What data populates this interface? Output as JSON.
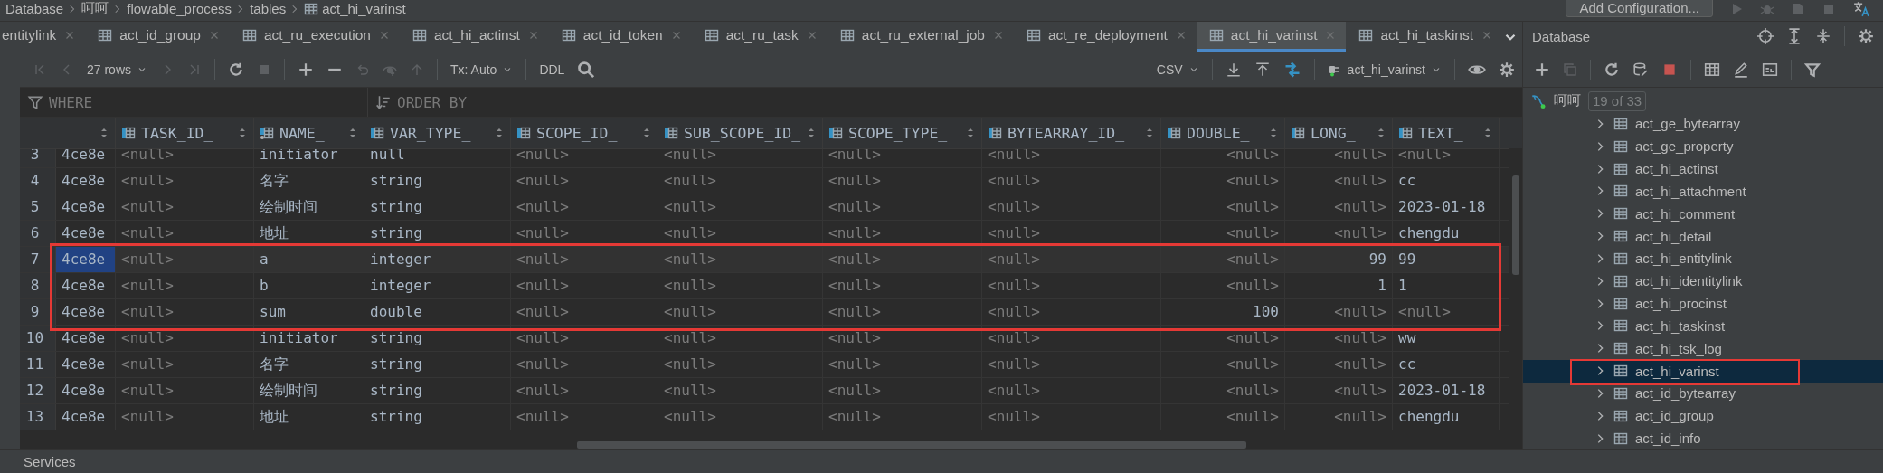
{
  "breadcrumb": [
    "Database",
    "呵呵",
    "flowable_process",
    "tables",
    "act_hi_varinst"
  ],
  "run_config": {
    "label": "Add Configuration..."
  },
  "tabs": [
    {
      "label": "entitylink",
      "kind": "partial",
      "selected": false
    },
    {
      "label": "act_id_group",
      "kind": "table",
      "selected": false
    },
    {
      "label": "act_ru_execution",
      "kind": "table",
      "selected": false
    },
    {
      "label": "act_hi_actinst",
      "kind": "table",
      "selected": false
    },
    {
      "label": "act_id_token",
      "kind": "table",
      "selected": false
    },
    {
      "label": "act_ru_task",
      "kind": "table",
      "selected": false
    },
    {
      "label": "act_ru_external_job",
      "kind": "table",
      "selected": false
    },
    {
      "label": "act_re_deployment",
      "kind": "table",
      "selected": false
    },
    {
      "label": "act_hi_varinst",
      "kind": "table",
      "selected": true
    },
    {
      "label": "act_hi_taskinst",
      "kind": "table",
      "selected": false
    }
  ],
  "toolbar": {
    "rows": "27 rows",
    "tx": "Tx: Auto",
    "ddl": "DDL",
    "format": "CSV",
    "datasource": "act_hi_varinst"
  },
  "filter": {
    "where": "WHERE",
    "order_by": "ORDER BY"
  },
  "table": {
    "columns": [
      {
        "kind": "text"
      },
      {
        "label": "TASK_ID_",
        "kind": "text",
        "indexed": false
      },
      {
        "label": "NAME_",
        "kind": "text",
        "indexed": true
      },
      {
        "label": "VAR_TYPE_",
        "kind": "text",
        "indexed": false
      },
      {
        "label": "SCOPE_ID_",
        "kind": "text",
        "indexed": false
      },
      {
        "label": "SUB_SCOPE_ID_",
        "kind": "text",
        "indexed": false
      },
      {
        "label": "SCOPE_TYPE_",
        "kind": "text",
        "indexed": false
      },
      {
        "label": "BYTEARRAY_ID_",
        "kind": "text",
        "indexed": false
      },
      {
        "label": "DOUBLE_",
        "kind": "number",
        "indexed": false
      },
      {
        "label": "LONG_",
        "kind": "number",
        "indexed": false
      },
      {
        "label": "TEXT_",
        "kind": "text",
        "indexed": false
      }
    ],
    "rows": [
      {
        "number": "3",
        "selected": false,
        "marked": false,
        "cells": [
          {
            "text": "4ce8e",
            "null": false
          },
          {
            "text": "<null>",
            "null": true
          },
          {
            "text": "initiator",
            "null": false
          },
          {
            "text": "null",
            "null": false
          },
          {
            "text": "<null>",
            "null": true
          },
          {
            "text": "<null>",
            "null": true
          },
          {
            "text": "<null>",
            "null": true
          },
          {
            "text": "<null>",
            "null": true
          },
          {
            "text": "<null>",
            "null": true
          },
          {
            "text": "<null>",
            "null": true
          },
          {
            "text": "<null>",
            "null": true
          }
        ]
      },
      {
        "number": "4",
        "selected": false,
        "marked": false,
        "cells": [
          {
            "text": "4ce8e",
            "null": false
          },
          {
            "text": "<null>",
            "null": true
          },
          {
            "text": "名字",
            "null": false
          },
          {
            "text": "string",
            "null": false
          },
          {
            "text": "<null>",
            "null": true
          },
          {
            "text": "<null>",
            "null": true
          },
          {
            "text": "<null>",
            "null": true
          },
          {
            "text": "<null>",
            "null": true
          },
          {
            "text": "<null>",
            "null": true
          },
          {
            "text": "<null>",
            "null": true
          },
          {
            "text": "cc",
            "null": false
          }
        ]
      },
      {
        "number": "5",
        "selected": false,
        "marked": false,
        "cells": [
          {
            "text": "4ce8e",
            "null": false
          },
          {
            "text": "<null>",
            "null": true
          },
          {
            "text": "绘制时间",
            "null": false
          },
          {
            "text": "string",
            "null": false
          },
          {
            "text": "<null>",
            "null": true
          },
          {
            "text": "<null>",
            "null": true
          },
          {
            "text": "<null>",
            "null": true
          },
          {
            "text": "<null>",
            "null": true
          },
          {
            "text": "<null>",
            "null": true
          },
          {
            "text": "<null>",
            "null": true
          },
          {
            "text": "2023-01-18",
            "null": false
          }
        ]
      },
      {
        "number": "6",
        "selected": false,
        "marked": false,
        "cells": [
          {
            "text": "4ce8e",
            "null": false
          },
          {
            "text": "<null>",
            "null": true
          },
          {
            "text": "地址",
            "null": false
          },
          {
            "text": "string",
            "null": false
          },
          {
            "text": "<null>",
            "null": true
          },
          {
            "text": "<null>",
            "null": true
          },
          {
            "text": "<null>",
            "null": true
          },
          {
            "text": "<null>",
            "null": true
          },
          {
            "text": "<null>",
            "null": true
          },
          {
            "text": "<null>",
            "null": true
          },
          {
            "text": "chengdu",
            "null": false
          }
        ]
      },
      {
        "number": "7",
        "selected": true,
        "marked": true,
        "cells": [
          {
            "text": "4ce8e",
            "null": false
          },
          {
            "text": "<null>",
            "null": true
          },
          {
            "text": "a",
            "null": false
          },
          {
            "text": "integer",
            "null": false
          },
          {
            "text": "<null>",
            "null": true
          },
          {
            "text": "<null>",
            "null": true
          },
          {
            "text": "<null>",
            "null": true
          },
          {
            "text": "<null>",
            "null": true
          },
          {
            "text": "<null>",
            "null": true
          },
          {
            "text": "99",
            "null": false
          },
          {
            "text": "99",
            "null": false
          }
        ]
      },
      {
        "number": "8",
        "selected": false,
        "marked": true,
        "cells": [
          {
            "text": "4ce8e",
            "null": false
          },
          {
            "text": "<null>",
            "null": true
          },
          {
            "text": "b",
            "null": false
          },
          {
            "text": "integer",
            "null": false
          },
          {
            "text": "<null>",
            "null": true
          },
          {
            "text": "<null>",
            "null": true
          },
          {
            "text": "<null>",
            "null": true
          },
          {
            "text": "<null>",
            "null": true
          },
          {
            "text": "<null>",
            "null": true
          },
          {
            "text": "1",
            "null": false
          },
          {
            "text": "1",
            "null": false
          }
        ]
      },
      {
        "number": "9",
        "selected": false,
        "marked": true,
        "cells": [
          {
            "text": "4ce8e",
            "null": false
          },
          {
            "text": "<null>",
            "null": true
          },
          {
            "text": "sum",
            "null": false
          },
          {
            "text": "double",
            "null": false
          },
          {
            "text": "<null>",
            "null": true
          },
          {
            "text": "<null>",
            "null": true
          },
          {
            "text": "<null>",
            "null": true
          },
          {
            "text": "<null>",
            "null": true
          },
          {
            "text": "100",
            "null": false
          },
          {
            "text": "<null>",
            "null": true
          },
          {
            "text": "<null>",
            "null": true
          }
        ]
      },
      {
        "number": "10",
        "selected": false,
        "marked": false,
        "cells": [
          {
            "text": "4ce8e",
            "null": false
          },
          {
            "text": "<null>",
            "null": true
          },
          {
            "text": "initiator",
            "null": false
          },
          {
            "text": "string",
            "null": false
          },
          {
            "text": "<null>",
            "null": true
          },
          {
            "text": "<null>",
            "null": true
          },
          {
            "text": "<null>",
            "null": true
          },
          {
            "text": "<null>",
            "null": true
          },
          {
            "text": "<null>",
            "null": true
          },
          {
            "text": "<null>",
            "null": true
          },
          {
            "text": "ww",
            "null": false
          }
        ]
      },
      {
        "number": "11",
        "selected": false,
        "marked": false,
        "cells": [
          {
            "text": "4ce8e",
            "null": false
          },
          {
            "text": "<null>",
            "null": true
          },
          {
            "text": "名字",
            "null": false
          },
          {
            "text": "string",
            "null": false
          },
          {
            "text": "<null>",
            "null": true
          },
          {
            "text": "<null>",
            "null": true
          },
          {
            "text": "<null>",
            "null": true
          },
          {
            "text": "<null>",
            "null": true
          },
          {
            "text": "<null>",
            "null": true
          },
          {
            "text": "<null>",
            "null": true
          },
          {
            "text": "cc",
            "null": false
          }
        ]
      },
      {
        "number": "12",
        "selected": false,
        "marked": false,
        "cells": [
          {
            "text": "4ce8e",
            "null": false
          },
          {
            "text": "<null>",
            "null": true
          },
          {
            "text": "绘制时间",
            "null": false
          },
          {
            "text": "string",
            "null": false
          },
          {
            "text": "<null>",
            "null": true
          },
          {
            "text": "<null>",
            "null": true
          },
          {
            "text": "<null>",
            "null": true
          },
          {
            "text": "<null>",
            "null": true
          },
          {
            "text": "<null>",
            "null": true
          },
          {
            "text": "<null>",
            "null": true
          },
          {
            "text": "2023-01-18",
            "null": false
          }
        ]
      },
      {
        "number": "13",
        "selected": false,
        "marked": false,
        "cells": [
          {
            "text": "4ce8e",
            "null": false
          },
          {
            "text": "<null>",
            "null": true
          },
          {
            "text": "地址",
            "null": false
          },
          {
            "text": "string",
            "null": false
          },
          {
            "text": "<null>",
            "null": true
          },
          {
            "text": "<null>",
            "null": true
          },
          {
            "text": "<null>",
            "null": true
          },
          {
            "text": "<null>",
            "null": true
          },
          {
            "text": "<null>",
            "null": true
          },
          {
            "text": "<null>",
            "null": true
          },
          {
            "text": "chengdu",
            "null": false
          }
        ]
      }
    ]
  },
  "sidebar": {
    "title": "Database",
    "root": {
      "label": "呵呵",
      "badge": "19 of 33",
      "children": [
        {
          "label": "act_ge_bytearray",
          "selected": false,
          "marked": false
        },
        {
          "label": "act_ge_property",
          "selected": false,
          "marked": false
        },
        {
          "label": "act_hi_actinst",
          "selected": false,
          "marked": false
        },
        {
          "label": "act_hi_attachment",
          "selected": false,
          "marked": false
        },
        {
          "label": "act_hi_comment",
          "selected": false,
          "marked": false
        },
        {
          "label": "act_hi_detail",
          "selected": false,
          "marked": false
        },
        {
          "label": "act_hi_entitylink",
          "selected": false,
          "marked": false
        },
        {
          "label": "act_hi_identitylink",
          "selected": false,
          "marked": false
        },
        {
          "label": "act_hi_procinst",
          "selected": false,
          "marked": false
        },
        {
          "label": "act_hi_taskinst",
          "selected": false,
          "marked": false
        },
        {
          "label": "act_hi_tsk_log",
          "selected": false,
          "marked": false
        },
        {
          "label": "act_hi_varinst",
          "selected": true,
          "marked": true
        },
        {
          "label": "act_id_bytearray",
          "selected": false,
          "marked": false
        },
        {
          "label": "act_id_group",
          "selected": false,
          "marked": false
        },
        {
          "label": "act_id_info",
          "selected": false,
          "marked": false
        }
      ]
    }
  },
  "services": "Services"
}
